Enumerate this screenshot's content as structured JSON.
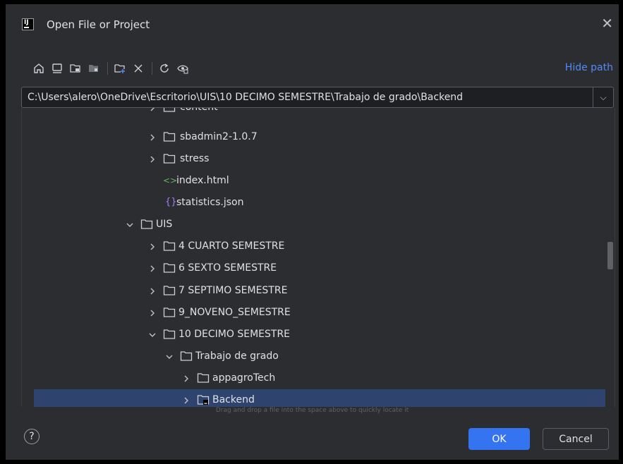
{
  "window": {
    "title": "Open File or Project",
    "logo_text": "IJ"
  },
  "toolbar": {
    "icons": [
      "home-icon",
      "desktop-icon",
      "project-folder-icon",
      "module-folder-icon",
      "new-folder-icon",
      "delete-icon",
      "refresh-icon",
      "show-hidden-icon"
    ],
    "hide_path_label": "Hide path"
  },
  "path": {
    "value": "C:\\Users\\alero\\OneDrive\\Escritorio\\UIS\\10 DECIMO SEMESTRE\\Trabajo de grado\\Backend"
  },
  "tree": {
    "items": [
      {
        "label": "content",
        "type": "folder",
        "depth": 1,
        "expanded": false
      },
      {
        "label": "sbadmin2-1.0.7",
        "type": "folder",
        "depth": 1,
        "expanded": false
      },
      {
        "label": "stress",
        "type": "folder",
        "depth": 1,
        "expanded": false
      },
      {
        "label": "index.html",
        "type": "html",
        "depth": 1
      },
      {
        "label": "statistics.json",
        "type": "json",
        "depth": 1
      },
      {
        "label": "UIS",
        "type": "folder",
        "depth": 0,
        "expanded": true
      },
      {
        "label": "4 CUARTO SEMESTRE",
        "type": "folder",
        "depth": 1,
        "expanded": false
      },
      {
        "label": "6 SEXTO SEMESTRE",
        "type": "folder",
        "depth": 1,
        "expanded": false
      },
      {
        "label": "7 SEPTIMO SEMESTRE",
        "type": "folder",
        "depth": 1,
        "expanded": false
      },
      {
        "label": "9_NOVENO_SEMESTRE",
        "type": "folder",
        "depth": 1,
        "expanded": false
      },
      {
        "label": "10 DECIMO SEMESTRE",
        "type": "folder",
        "depth": 1,
        "expanded": true
      },
      {
        "label": "Trabajo de grado",
        "type": "folder",
        "depth": 2,
        "expanded": true
      },
      {
        "label": "appagroTech",
        "type": "folder",
        "depth": 3,
        "expanded": false
      },
      {
        "label": "Backend",
        "type": "project-folder",
        "depth": 3,
        "expanded": false,
        "selected": true
      }
    ]
  },
  "hint": "Drag and drop a file into the space above to quickly locate it",
  "footer": {
    "help_label": "?",
    "ok_label": "OK",
    "cancel_label": "Cancel"
  },
  "colors": {
    "background": "#2b2d30",
    "selection": "#2e436e",
    "accent": "#3574f0",
    "link": "#548af7"
  }
}
